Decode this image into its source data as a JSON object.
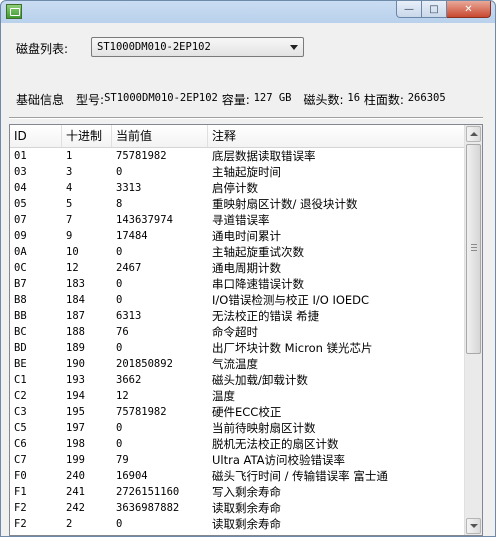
{
  "window": {
    "controls": {
      "minimize": "—",
      "maximize": "□",
      "close": "✕"
    },
    "icon": "app-icon"
  },
  "disk_select": {
    "label": "磁盘列表:",
    "value": "ST1000DM010-2EP102"
  },
  "info": {
    "section_label": "基础信息",
    "model_label": "型号:",
    "model": "ST1000DM010-2EP102",
    "capacity_label": "容量:",
    "capacity": "127 GB",
    "heads_label": "磁头数:",
    "heads": "16",
    "cylinders_label": "柱面数:",
    "cylinders": "266305"
  },
  "table": {
    "columns": [
      "ID",
      "十进制",
      "当前值",
      "注释"
    ],
    "rows": [
      {
        "id": "01",
        "dec": "1",
        "cur": "75781982",
        "note": "底层数据读取错误率"
      },
      {
        "id": "03",
        "dec": "3",
        "cur": "0",
        "note": "主轴起旋时间"
      },
      {
        "id": "04",
        "dec": "4",
        "cur": "3313",
        "note": "启停计数"
      },
      {
        "id": "05",
        "dec": "5",
        "cur": "8",
        "note": "重映射扇区计数/ 退役块计数"
      },
      {
        "id": "07",
        "dec": "7",
        "cur": "143637974",
        "note": "寻道错误率"
      },
      {
        "id": "09",
        "dec": "9",
        "cur": "17484",
        "note": "通电时间累计"
      },
      {
        "id": "0A",
        "dec": "10",
        "cur": "0",
        "note": "主轴起旋重试次数"
      },
      {
        "id": "0C",
        "dec": "12",
        "cur": "2467",
        "note": "通电周期计数"
      },
      {
        "id": "B7",
        "dec": "183",
        "cur": "0",
        "note": "串口降速错误计数"
      },
      {
        "id": "B8",
        "dec": "184",
        "cur": "0",
        "note": "I/O错误检测与校正 I/O IOEDC"
      },
      {
        "id": "BB",
        "dec": "187",
        "cur": "6313",
        "note": "无法校正的错误  希捷"
      },
      {
        "id": "BC",
        "dec": "188",
        "cur": "76",
        "note": "命令超时"
      },
      {
        "id": "BD",
        "dec": "189",
        "cur": "0",
        "note": "出厂坏块计数  Micron 镁光芯片"
      },
      {
        "id": "BE",
        "dec": "190",
        "cur": "201850892",
        "note": "气流温度"
      },
      {
        "id": "C1",
        "dec": "193",
        "cur": "3662",
        "note": "磁头加载/卸载计数"
      },
      {
        "id": "C2",
        "dec": "194",
        "cur": "12",
        "note": "温度"
      },
      {
        "id": "C3",
        "dec": "195",
        "cur": "75781982",
        "note": "硬件ECC校正"
      },
      {
        "id": "C5",
        "dec": "197",
        "cur": "0",
        "note": "当前待映射扇区计数"
      },
      {
        "id": "C6",
        "dec": "198",
        "cur": "0",
        "note": "脱机无法校正的扇区计数"
      },
      {
        "id": "C7",
        "dec": "199",
        "cur": "79",
        "note": "Ultra ATA访问校验错误率"
      },
      {
        "id": "F0",
        "dec": "240",
        "cur": "16904",
        "note": "磁头飞行时间  / 传输错误率 富士通"
      },
      {
        "id": "F1",
        "dec": "241",
        "cur": "2726151160",
        "note": "写入剩余寿命"
      },
      {
        "id": "F2",
        "dec": "242",
        "cur": "3636987882",
        "note": "读取剩余寿命"
      },
      {
        "id": "F2",
        "dec": "2",
        "cur": "0",
        "note": "读取剩余寿命"
      }
    ]
  }
}
